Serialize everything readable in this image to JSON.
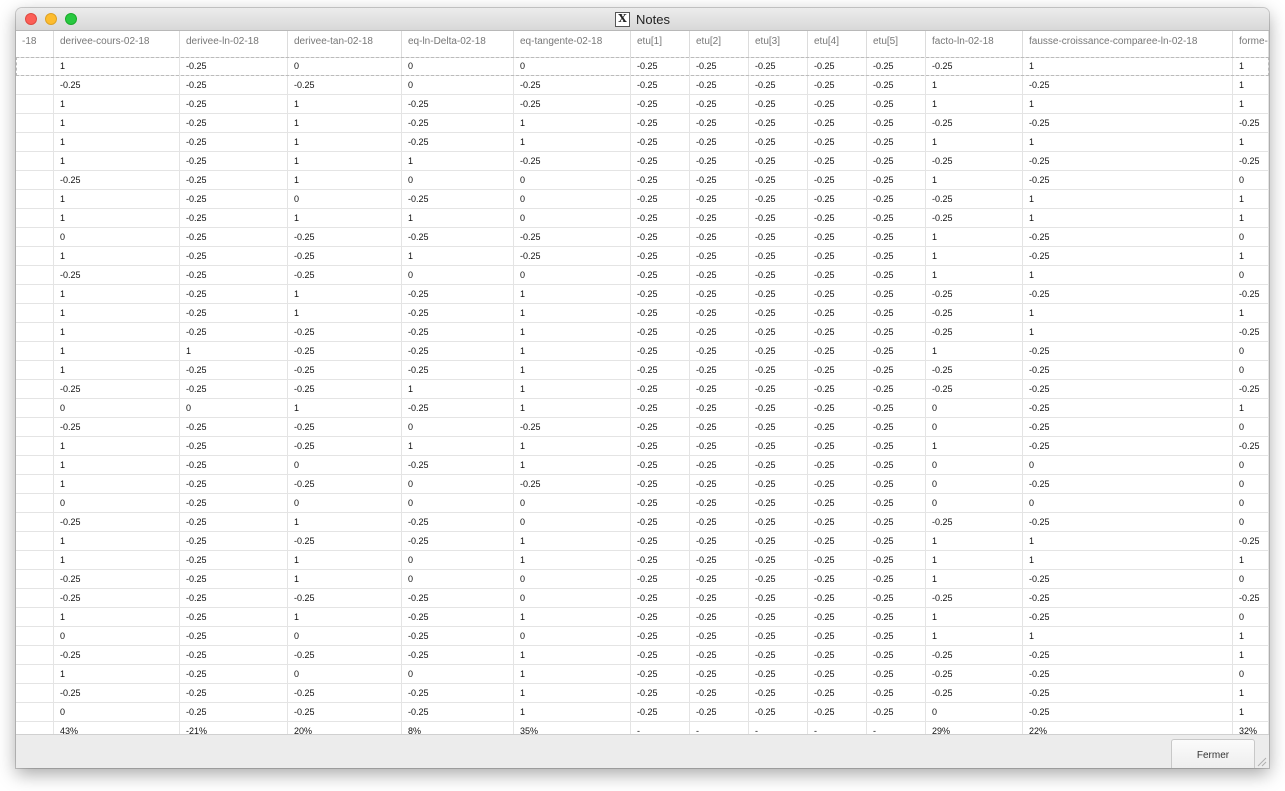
{
  "window": {
    "title": "Notes",
    "app_icon": "x11-icon"
  },
  "table": {
    "columns": [
      "-18",
      "derivee-cours-02-18",
      "derivee-ln-02-18",
      "derivee-tan-02-18",
      "eq-ln-Delta-02-18",
      "eq-tangente-02-18",
      "etu[1]",
      "etu[2]",
      "etu[3]",
      "etu[4]",
      "etu[5]",
      "facto-ln-02-18",
      "fausse-croissance-comparee-ln-02-18",
      "forme-"
    ],
    "rows": [
      [
        "",
        "1",
        "-0.25",
        "0",
        "0",
        "0",
        "-0.25",
        "-0.25",
        "-0.25",
        "-0.25",
        "-0.25",
        "-0.25",
        "1",
        "1"
      ],
      [
        "",
        "-0.25",
        "-0.25",
        "-0.25",
        "0",
        "-0.25",
        "-0.25",
        "-0.25",
        "-0.25",
        "-0.25",
        "-0.25",
        "1",
        "-0.25",
        "1"
      ],
      [
        "",
        "1",
        "-0.25",
        "1",
        "-0.25",
        "-0.25",
        "-0.25",
        "-0.25",
        "-0.25",
        "-0.25",
        "-0.25",
        "1",
        "1",
        "1"
      ],
      [
        "",
        "1",
        "-0.25",
        "1",
        "-0.25",
        "1",
        "-0.25",
        "-0.25",
        "-0.25",
        "-0.25",
        "-0.25",
        "-0.25",
        "-0.25",
        "-0.25"
      ],
      [
        "",
        "1",
        "-0.25",
        "1",
        "-0.25",
        "1",
        "-0.25",
        "-0.25",
        "-0.25",
        "-0.25",
        "-0.25",
        "1",
        "1",
        "1"
      ],
      [
        "",
        "1",
        "-0.25",
        "1",
        "1",
        "-0.25",
        "-0.25",
        "-0.25",
        "-0.25",
        "-0.25",
        "-0.25",
        "-0.25",
        "-0.25",
        "-0.25"
      ],
      [
        "",
        "-0.25",
        "-0.25",
        "1",
        "0",
        "0",
        "-0.25",
        "-0.25",
        "-0.25",
        "-0.25",
        "-0.25",
        "1",
        "-0.25",
        "0"
      ],
      [
        "",
        "1",
        "-0.25",
        "0",
        "-0.25",
        "0",
        "-0.25",
        "-0.25",
        "-0.25",
        "-0.25",
        "-0.25",
        "-0.25",
        "1",
        "1"
      ],
      [
        "",
        "1",
        "-0.25",
        "1",
        "1",
        "0",
        "-0.25",
        "-0.25",
        "-0.25",
        "-0.25",
        "-0.25",
        "-0.25",
        "1",
        "1"
      ],
      [
        "",
        "0",
        "-0.25",
        "-0.25",
        "-0.25",
        "-0.25",
        "-0.25",
        "-0.25",
        "-0.25",
        "-0.25",
        "-0.25",
        "1",
        "-0.25",
        "0"
      ],
      [
        "",
        "1",
        "-0.25",
        "-0.25",
        "1",
        "-0.25",
        "-0.25",
        "-0.25",
        "-0.25",
        "-0.25",
        "-0.25",
        "1",
        "-0.25",
        "1"
      ],
      [
        "",
        "-0.25",
        "-0.25",
        "-0.25",
        "0",
        "0",
        "-0.25",
        "-0.25",
        "-0.25",
        "-0.25",
        "-0.25",
        "1",
        "1",
        "0"
      ],
      [
        "",
        "1",
        "-0.25",
        "1",
        "-0.25",
        "1",
        "-0.25",
        "-0.25",
        "-0.25",
        "-0.25",
        "-0.25",
        "-0.25",
        "-0.25",
        "-0.25"
      ],
      [
        "",
        "1",
        "-0.25",
        "1",
        "-0.25",
        "1",
        "-0.25",
        "-0.25",
        "-0.25",
        "-0.25",
        "-0.25",
        "-0.25",
        "1",
        "1"
      ],
      [
        "",
        "1",
        "-0.25",
        "-0.25",
        "-0.25",
        "1",
        "-0.25",
        "-0.25",
        "-0.25",
        "-0.25",
        "-0.25",
        "-0.25",
        "1",
        "-0.25"
      ],
      [
        "",
        "1",
        "1",
        "-0.25",
        "-0.25",
        "1",
        "-0.25",
        "-0.25",
        "-0.25",
        "-0.25",
        "-0.25",
        "1",
        "-0.25",
        "0"
      ],
      [
        "",
        "1",
        "-0.25",
        "-0.25",
        "-0.25",
        "1",
        "-0.25",
        "-0.25",
        "-0.25",
        "-0.25",
        "-0.25",
        "-0.25",
        "-0.25",
        "0"
      ],
      [
        "",
        "-0.25",
        "-0.25",
        "-0.25",
        "1",
        "1",
        "-0.25",
        "-0.25",
        "-0.25",
        "-0.25",
        "-0.25",
        "-0.25",
        "-0.25",
        "-0.25"
      ],
      [
        "",
        "0",
        "0",
        "1",
        "-0.25",
        "1",
        "-0.25",
        "-0.25",
        "-0.25",
        "-0.25",
        "-0.25",
        "0",
        "-0.25",
        "1"
      ],
      [
        "",
        "-0.25",
        "-0.25",
        "-0.25",
        "0",
        "-0.25",
        "-0.25",
        "-0.25",
        "-0.25",
        "-0.25",
        "-0.25",
        "0",
        "-0.25",
        "0"
      ],
      [
        "",
        "1",
        "-0.25",
        "-0.25",
        "1",
        "1",
        "-0.25",
        "-0.25",
        "-0.25",
        "-0.25",
        "-0.25",
        "1",
        "-0.25",
        "-0.25"
      ],
      [
        "",
        "1",
        "-0.25",
        "0",
        "-0.25",
        "1",
        "-0.25",
        "-0.25",
        "-0.25",
        "-0.25",
        "-0.25",
        "0",
        "0",
        "0"
      ],
      [
        "",
        "1",
        "-0.25",
        "-0.25",
        "0",
        "-0.25",
        "-0.25",
        "-0.25",
        "-0.25",
        "-0.25",
        "-0.25",
        "0",
        "-0.25",
        "0"
      ],
      [
        "",
        "0",
        "-0.25",
        "0",
        "0",
        "0",
        "-0.25",
        "-0.25",
        "-0.25",
        "-0.25",
        "-0.25",
        "0",
        "0",
        "0"
      ],
      [
        "",
        "-0.25",
        "-0.25",
        "1",
        "-0.25",
        "0",
        "-0.25",
        "-0.25",
        "-0.25",
        "-0.25",
        "-0.25",
        "-0.25",
        "-0.25",
        "0"
      ],
      [
        "",
        "1",
        "-0.25",
        "-0.25",
        "-0.25",
        "1",
        "-0.25",
        "-0.25",
        "-0.25",
        "-0.25",
        "-0.25",
        "1",
        "1",
        "-0.25"
      ],
      [
        "",
        "1",
        "-0.25",
        "1",
        "0",
        "1",
        "-0.25",
        "-0.25",
        "-0.25",
        "-0.25",
        "-0.25",
        "1",
        "1",
        "1"
      ],
      [
        "",
        "-0.25",
        "-0.25",
        "1",
        "0",
        "0",
        "-0.25",
        "-0.25",
        "-0.25",
        "-0.25",
        "-0.25",
        "1",
        "-0.25",
        "0"
      ],
      [
        "",
        "-0.25",
        "-0.25",
        "-0.25",
        "-0.25",
        "0",
        "-0.25",
        "-0.25",
        "-0.25",
        "-0.25",
        "-0.25",
        "-0.25",
        "-0.25",
        "-0.25"
      ],
      [
        "",
        "1",
        "-0.25",
        "1",
        "-0.25",
        "1",
        "-0.25",
        "-0.25",
        "-0.25",
        "-0.25",
        "-0.25",
        "1",
        "-0.25",
        "0"
      ],
      [
        "",
        "0",
        "-0.25",
        "0",
        "-0.25",
        "0",
        "-0.25",
        "-0.25",
        "-0.25",
        "-0.25",
        "-0.25",
        "1",
        "1",
        "1"
      ],
      [
        "",
        "-0.25",
        "-0.25",
        "-0.25",
        "-0.25",
        "1",
        "-0.25",
        "-0.25",
        "-0.25",
        "-0.25",
        "-0.25",
        "-0.25",
        "-0.25",
        "1"
      ],
      [
        "",
        "1",
        "-0.25",
        "0",
        "0",
        "1",
        "-0.25",
        "-0.25",
        "-0.25",
        "-0.25",
        "-0.25",
        "-0.25",
        "-0.25",
        "0"
      ],
      [
        "",
        "-0.25",
        "-0.25",
        "-0.25",
        "-0.25",
        "1",
        "-0.25",
        "-0.25",
        "-0.25",
        "-0.25",
        "-0.25",
        "-0.25",
        "-0.25",
        "1"
      ],
      [
        "",
        "0",
        "-0.25",
        "-0.25",
        "-0.25",
        "1",
        "-0.25",
        "-0.25",
        "-0.25",
        "-0.25",
        "-0.25",
        "0",
        "-0.25",
        "1"
      ],
      [
        "",
        "43%",
        "-21%",
        "20%",
        "8%",
        "35%",
        "-",
        "-",
        "-",
        "-",
        "-",
        "29%",
        "22%",
        "32%"
      ]
    ]
  },
  "footer": {
    "close_label": "Fermer"
  }
}
